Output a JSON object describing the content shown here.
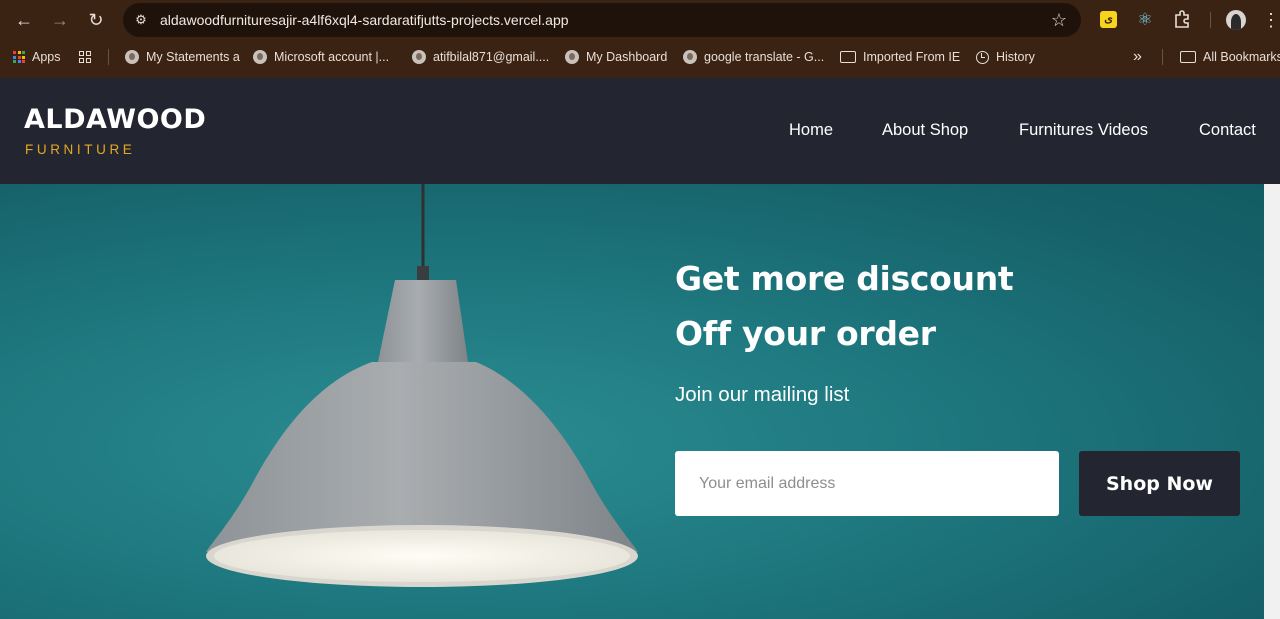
{
  "browser": {
    "url": "aldawoodfurnituresajir-a4lf6xql4-sardaratifjutts-projects.vercel.app",
    "nav_icons": [
      "back-arrow-icon",
      "forward-arrow-icon",
      "reload-icon"
    ],
    "extensions": [
      "yellow-extension-icon",
      "react-devtools-icon",
      "puzzle-extensions-icon"
    ],
    "extension_yellow_glyph": "ى"
  },
  "bookmarks": {
    "items": [
      {
        "label": "Apps",
        "icon": "apps-grid-icon"
      },
      {
        "label": "",
        "icon": "tiles-icon"
      },
      {
        "label": "My Statements a",
        "icon": "globe-icon"
      },
      {
        "label": "Microsoft account |...",
        "icon": "globe-icon"
      },
      {
        "label": "atifbilal871@gmail....",
        "icon": "globe-icon"
      },
      {
        "label": "My Dashboard",
        "icon": "globe-icon"
      },
      {
        "label": "google translate - G...",
        "icon": "globe-icon"
      },
      {
        "label": "Imported From IE",
        "icon": "folder-icon"
      },
      {
        "label": "History",
        "icon": "history-icon"
      }
    ],
    "overflow_label": "»",
    "all_bookmarks": "All Bookmarks"
  },
  "site": {
    "logo_main": "ALDAWOOD",
    "logo_sub": "FURNITURE",
    "nav": [
      "Home",
      "About Shop",
      "Furnitures Videos",
      "Contact"
    ]
  },
  "promo": {
    "title_line1": "Get more discount",
    "title_line2": "Off your order",
    "subtitle": "Join our mailing list",
    "email_placeholder": "Your email address",
    "button_label": "Shop Now"
  },
  "colors": {
    "chrome_bg": "#3b2314",
    "header_bg": "#232630",
    "accent": "#e4a823",
    "hero_bg": "#1f7980"
  }
}
